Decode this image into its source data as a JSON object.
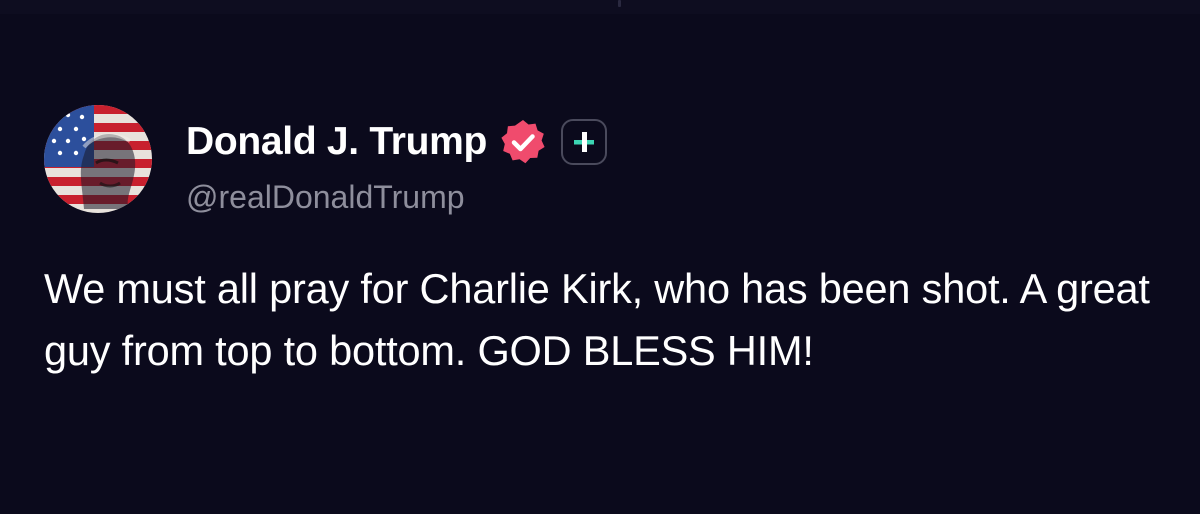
{
  "post": {
    "author": {
      "display_name": "Donald J. Trump",
      "handle": "@realDonaldTrump",
      "verified_icon": "verified-check-badge",
      "plus_icon": "plus-subscription-badge",
      "avatar_icon": "american-flag-portrait-avatar"
    },
    "text": "We must all pray for Charlie Kirk, who has been shot. A great guy from top to bottom. GOD BLESS HIM!"
  },
  "theme": {
    "background": "#0b0a1c",
    "text": "#ffffff",
    "handle": "#8e8e9c",
    "verified_badge": "#f04b6d",
    "plus_accent": "#3cd6b4"
  }
}
